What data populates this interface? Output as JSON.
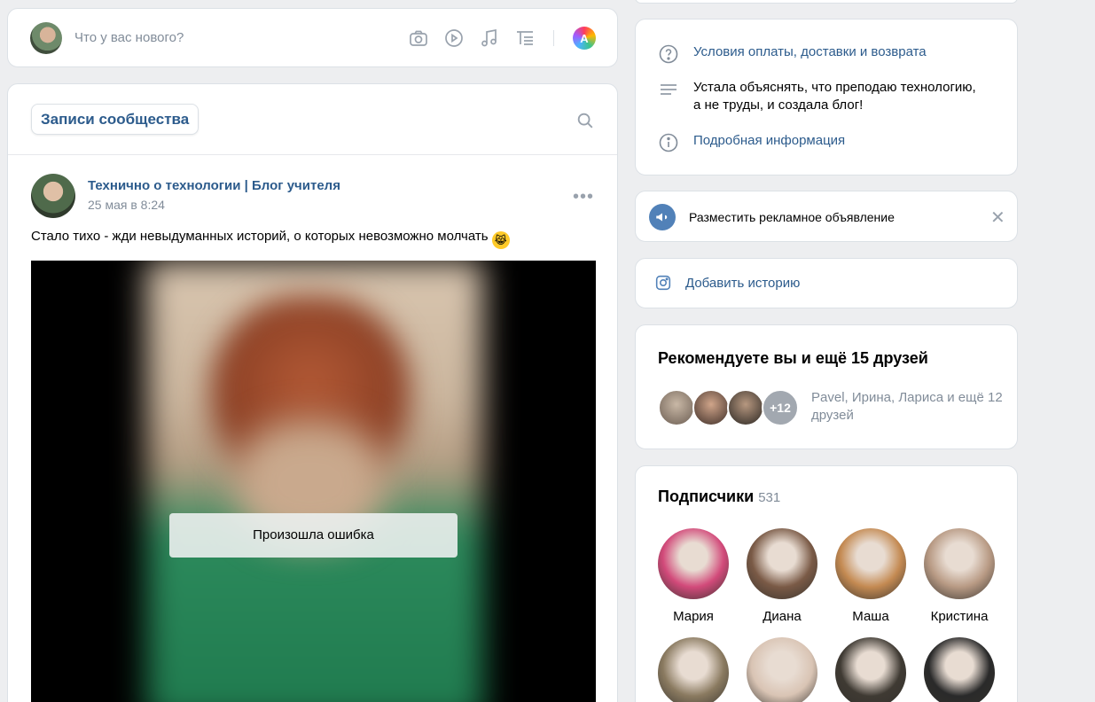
{
  "composer": {
    "placeholder": "Что у вас нового?",
    "tools": [
      "camera-icon",
      "video-icon",
      "music-icon",
      "article-icon"
    ],
    "ai_icon_letter": "A"
  },
  "feed": {
    "tab_label": "Записи сообщества",
    "post": {
      "author": "Технично о технологии | Блог учителя",
      "date": "25 мая в 8:24",
      "more": "•••",
      "text": "Стало тихо - жди невыдуманных историй, о которых невозможно молчать",
      "emoji": "😹",
      "error_text": "Произошла ошибка"
    }
  },
  "info": {
    "terms_link": "Условия оплаты, доставки и возврата",
    "description": "Устала объяснять, что преподаю технологию, а не труды, и создала блог!",
    "details_link": "Подробная информация"
  },
  "ads": {
    "label": "Разместить рекламное объявление",
    "close": "✕"
  },
  "story": {
    "label": "Добавить историю"
  },
  "recommend": {
    "title": "Рекомендуете вы и ещё 15 друзей",
    "more_badge": "+12",
    "friends_text": "Pavel, Ирина, Лариса и ещё 12 друзей"
  },
  "subscribers": {
    "title": "Подписчики",
    "count": "531",
    "people": [
      {
        "name": "Мария",
        "color": "#d24a7a"
      },
      {
        "name": "Диана",
        "color": "#7a5a46"
      },
      {
        "name": "Маша",
        "color": "#c48a52"
      },
      {
        "name": "Кристина",
        "color": "#b89a84"
      },
      {
        "name": "",
        "color": "#8a7a60"
      },
      {
        "name": "",
        "color": "#d9c4b4"
      },
      {
        "name": "",
        "color": "#3f3a33"
      },
      {
        "name": "",
        "color": "#2a2a2a"
      }
    ]
  }
}
